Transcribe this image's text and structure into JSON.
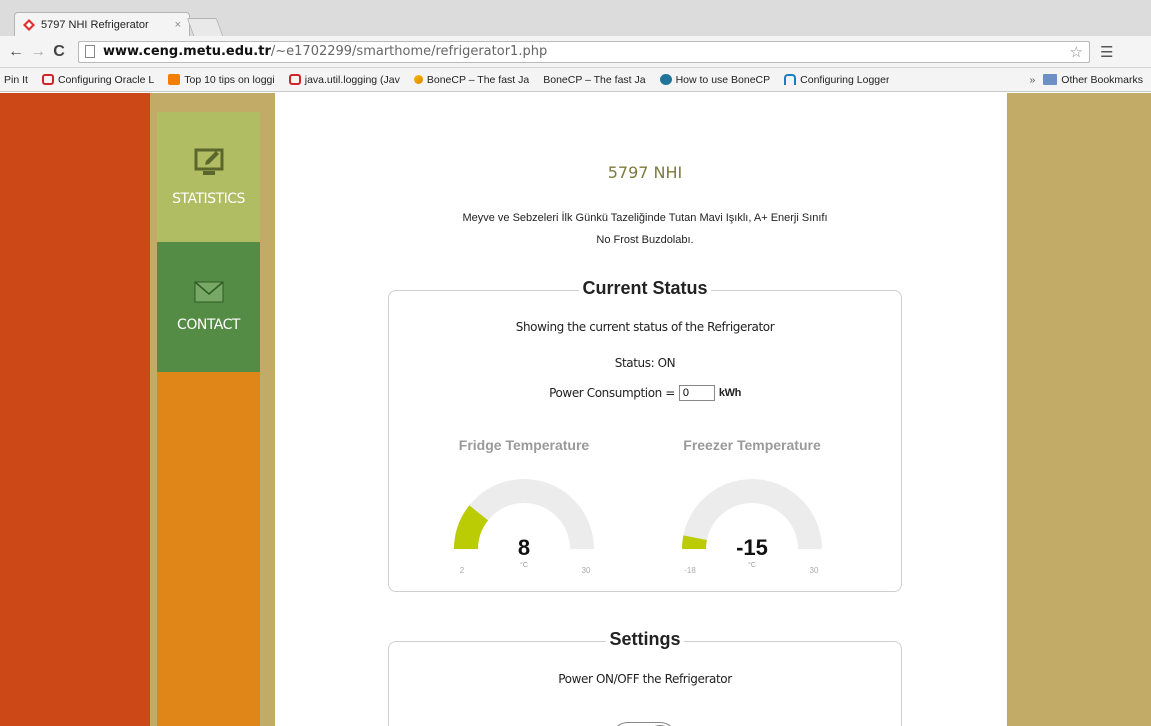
{
  "browser": {
    "tab_title": "5797 NHI Refrigerator",
    "tab_close": "×",
    "url_host": "www.ceng.metu.edu.tr",
    "url_path": "/~e1702299/smarthome/refrigerator1.php",
    "bookmarks": [
      {
        "label": "Pin It",
        "icon": "page-icon"
      },
      {
        "label": "Configuring Oracle L",
        "icon": "oracle-icon"
      },
      {
        "label": "Top 10 tips on loggi",
        "icon": "blogger-icon"
      },
      {
        "label": "java.util.logging (Jav",
        "icon": "oracle-icon"
      },
      {
        "label": "BoneCP – The fast Ja",
        "icon": "bonecp-icon"
      },
      {
        "label": "BoneCP – The fast Ja",
        "icon": "page-icon"
      },
      {
        "label": "How to use BoneCP",
        "icon": "wordpress-icon"
      },
      {
        "label": "Configuring Logger",
        "icon": "hn-icon"
      }
    ],
    "bookmarks_overflow": "»",
    "other_bookmarks": "Other Bookmarks"
  },
  "sidebar": {
    "items": [
      {
        "label": "STATISTICS",
        "icon": "monitor-pencil-icon"
      },
      {
        "label": "CONTACT",
        "icon": "envelope-icon"
      }
    ]
  },
  "product": {
    "title": "5797 NHI",
    "description_line1": "Meyve ve Sebzeleri İlk Günkü Tazeliğinde Tutan Mavi Işıklı, A+ Enerji Sınıfı",
    "description_line2": "No Frost Buzdolabı."
  },
  "current_status": {
    "legend": "Current Status",
    "subtitle": "Showing the current status of the Refrigerator",
    "status_text": "Status: ON",
    "power_label": "Power Consumption =",
    "power_value": "0",
    "power_unit": "kWh"
  },
  "gauges": [
    {
      "title": "Fridge Temperature",
      "value": 8,
      "min": 2,
      "max": 30,
      "unit": "°C",
      "value_label": "8",
      "min_label": "2",
      "max_label": "30"
    },
    {
      "title": "Freezer Temperature",
      "value": -15,
      "min": -18,
      "max": 30,
      "unit": "°C",
      "value_label": "-15",
      "min_label": "-18",
      "max_label": "30"
    }
  ],
  "settings": {
    "legend": "Settings",
    "power_toggle_label": "Power ON/OFF the Refrigerator"
  },
  "colors": {
    "gauge_fill": "#bccc04",
    "gauge_track": "#ececec",
    "red_strip": "#cd4817",
    "sidebar_orange": "#e08619",
    "statistics_green": "#b0bd62",
    "contact_green": "#548b45",
    "page_tan": "#c1ab67",
    "title_olive": "#7b7a3b"
  }
}
